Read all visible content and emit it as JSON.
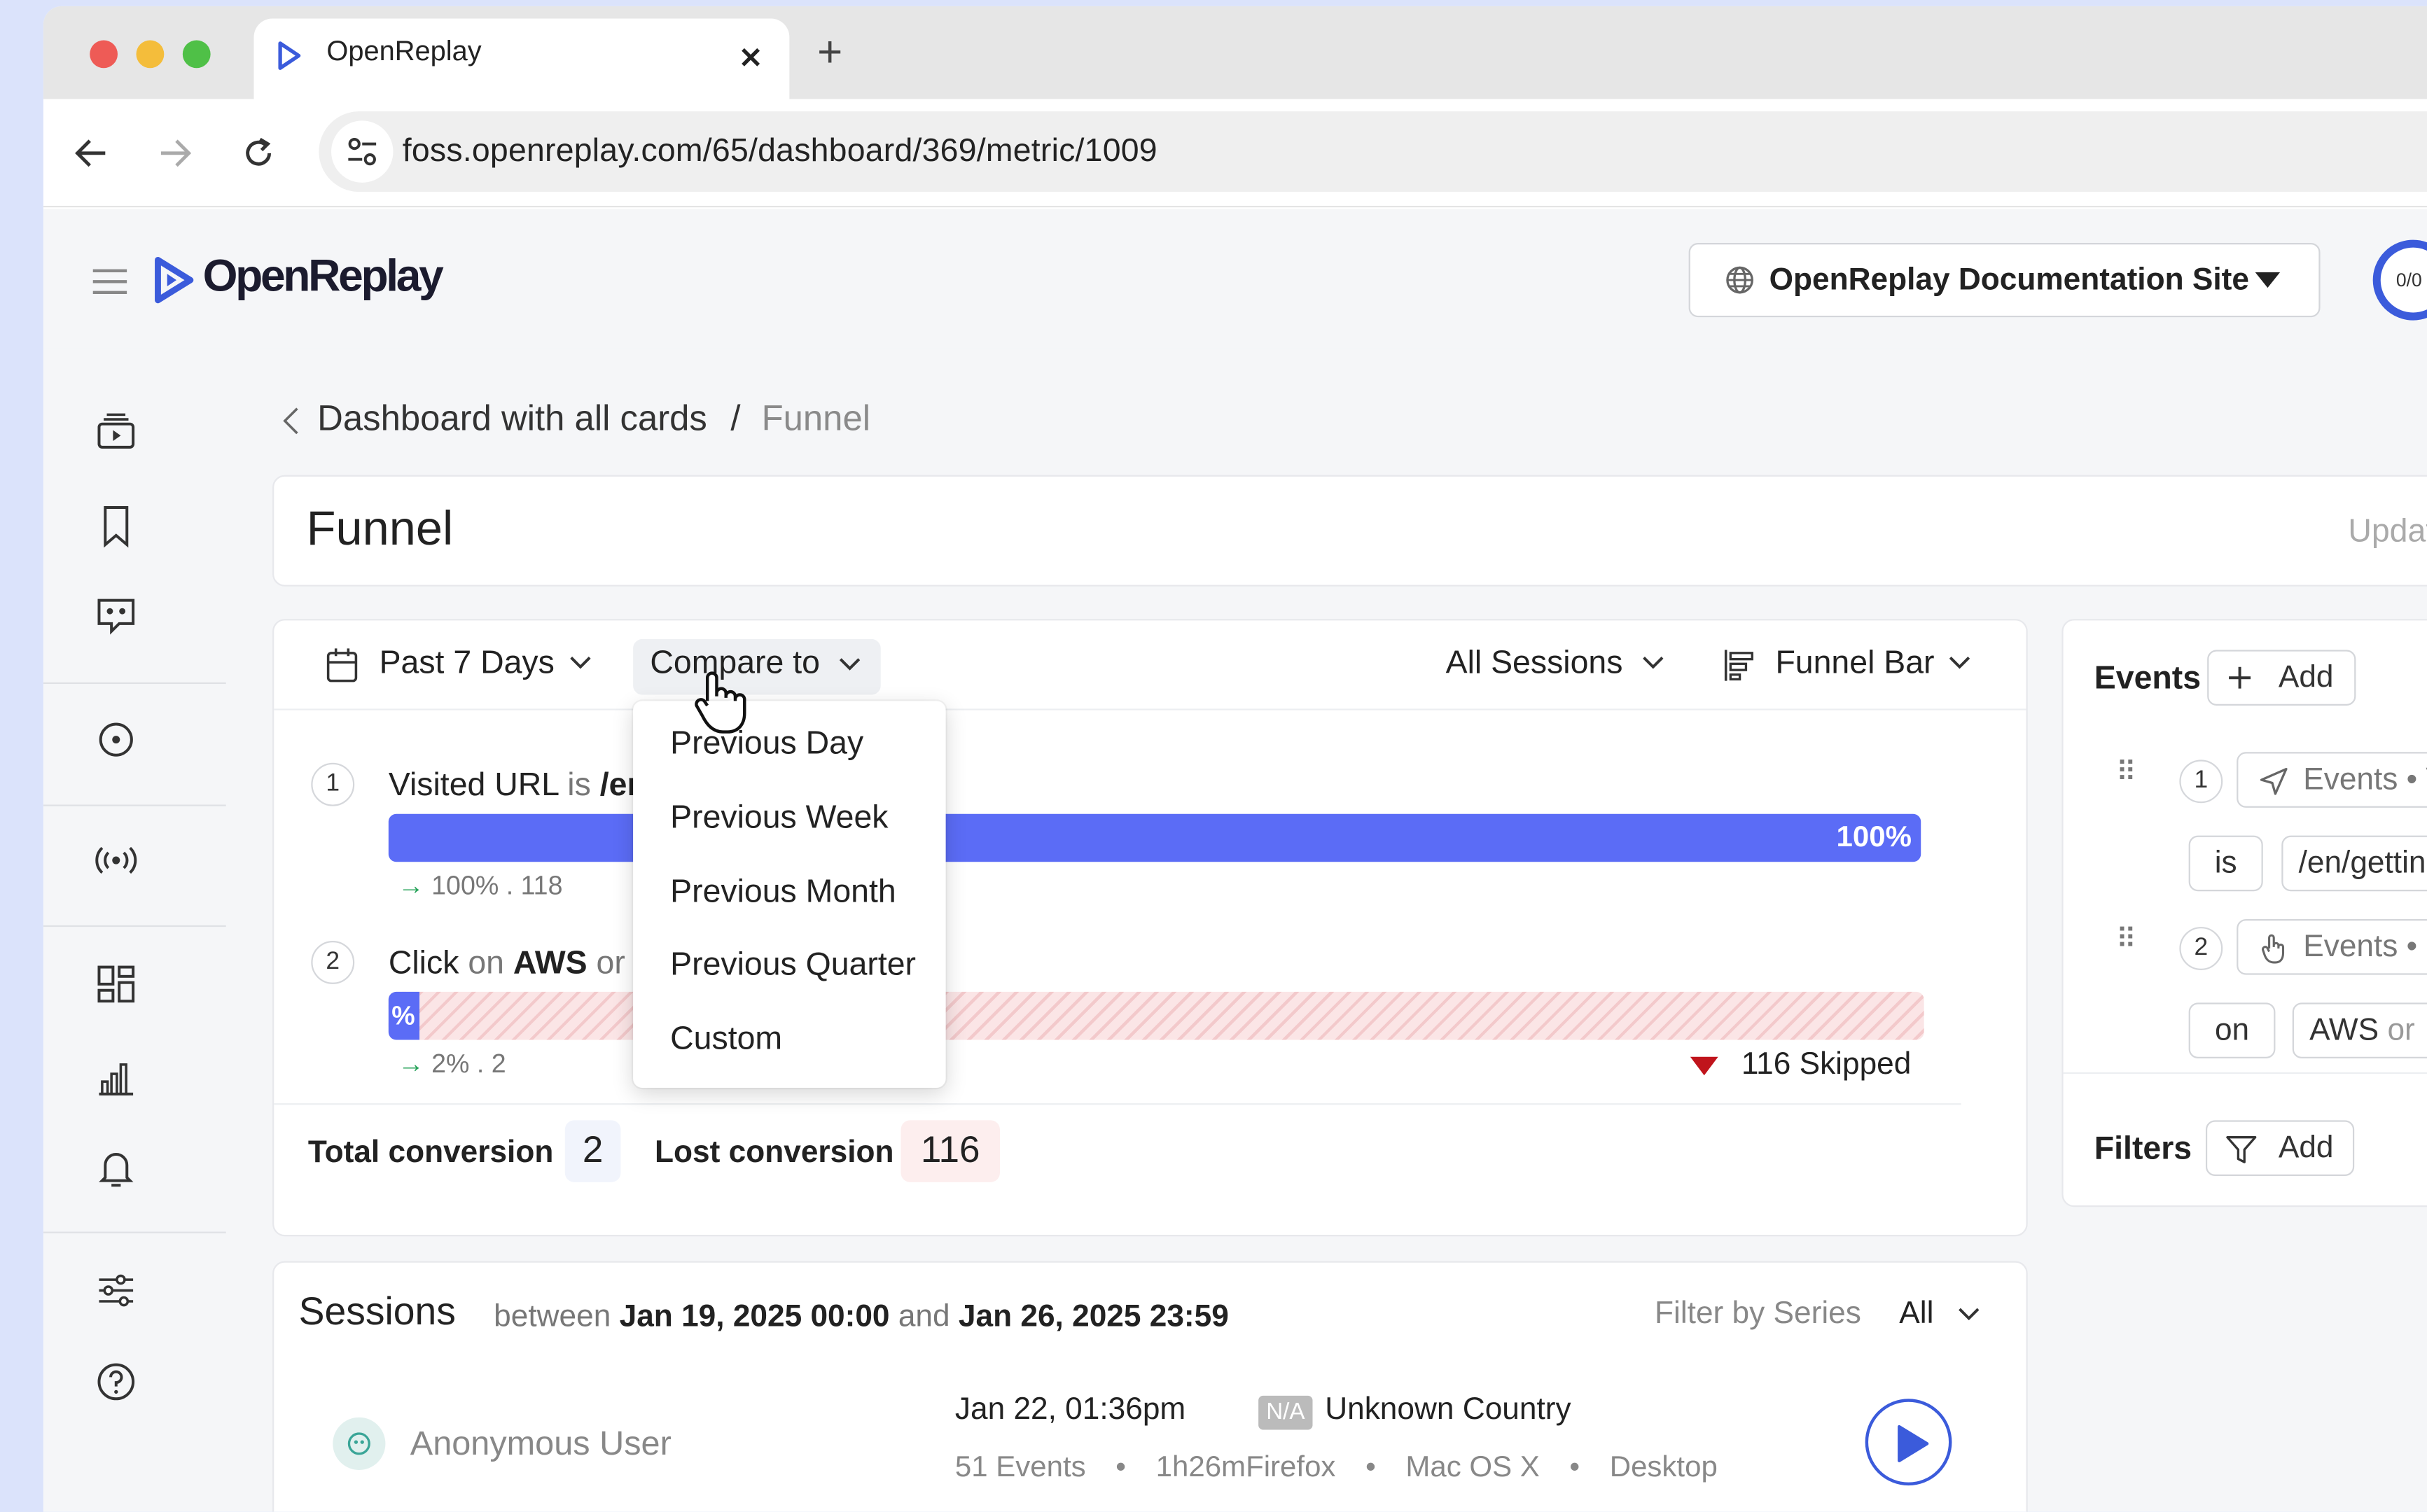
{
  "browser": {
    "tab_title": "OpenReplay",
    "url": "foss.openreplay.com/65/dashboard/369/metric/1009",
    "new_tab_label": "+"
  },
  "header": {
    "logo_text": "OpenReplay",
    "site_selector": "OpenReplay Documentation Site",
    "avatar_text": "0/0"
  },
  "breadcrumb": {
    "parent": "Dashboard with all cards",
    "separator": "/",
    "current": "Funnel"
  },
  "card": {
    "title": "Funnel",
    "updated_label": "Updat"
  },
  "toolbar": {
    "date_range": "Past 7 Days",
    "compare_to": "Compare to",
    "sessions_filter": "All Sessions",
    "view_type": "Funnel Bar"
  },
  "compare_menu": {
    "options": [
      "Previous Day",
      "Previous Week",
      "Previous Month",
      "Previous Quarter",
      "Custom"
    ]
  },
  "funnel": {
    "steps": [
      {
        "number": "1",
        "event": "Visited URL",
        "operator": "is",
        "value": "/er",
        "bar_label": "100%",
        "bar_fraction": 1.0,
        "sub_label": "100% . 118"
      },
      {
        "number": "2",
        "event": "Click",
        "operator": "on",
        "value": "AWS",
        "or_label": "or",
        "value_more": "A",
        "bar_label": "%",
        "bar_fraction": 0.02,
        "sub_label": "2% . 2",
        "skipped_label": "116 Skipped"
      }
    ],
    "total_conversion_label": "Total conversion",
    "total_conversion_value": "2",
    "lost_conversion_label": "Lost conversion",
    "lost_conversion_value": "116"
  },
  "events_panel": {
    "title": "Events",
    "add_label": "Add",
    "items": [
      {
        "number": "1",
        "type": "Events • V",
        "operator": "is",
        "value": "/en/gettin"
      },
      {
        "number": "2",
        "type": "Events • C",
        "operator": "on",
        "value": "AWS",
        "or_label": "or"
      }
    ],
    "filters_title": "Filters",
    "filters_add_label": "Add"
  },
  "sessions": {
    "title": "Sessions",
    "between_label": "between",
    "start": "Jan 19, 2025 00:00",
    "and_label": "and",
    "end": "Jan 26, 2025 23:59",
    "filter_by_series_label": "Filter by Series",
    "filter_value": "All",
    "rows": [
      {
        "user": "Anonymous User",
        "date": "Jan 22, 01:36pm",
        "country_badge": "N/A",
        "country": "Unknown Country",
        "events": "51 Events",
        "duration": "1h26m",
        "browser": "Firefox",
        "os": "Mac OS X",
        "device": "Desktop"
      }
    ]
  },
  "colors": {
    "accent": "#3b5bdb",
    "bar": "#5b6cf6",
    "skipped": "#c0141c",
    "conversion_green": "#27a35a"
  }
}
